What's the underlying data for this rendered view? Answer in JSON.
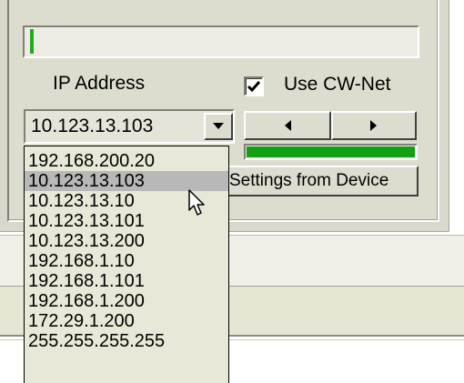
{
  "progress_top": {
    "percent": 1
  },
  "ip_address": {
    "label": "IP Address",
    "value": "10.123.13.103",
    "dropdown_icon": "chevron-down-icon",
    "options": [
      "192.168.200.20",
      "10.123.13.103",
      "10.123.13.10",
      "10.123.13.101",
      "10.123.13.200",
      "192.168.1.10",
      "192.168.1.101",
      "192.168.1.200",
      "172.29.1.200",
      "255.255.255.255"
    ],
    "highlighted_index": 1
  },
  "cw_net": {
    "label": "Use CW-Net",
    "checked": true
  },
  "nav": {
    "prev_icon": "arrow-left-icon",
    "next_icon": "arrow-right-icon"
  },
  "progress_mid": {
    "percent": 100
  },
  "settings_button": {
    "label": "Settings from Device"
  },
  "colors": {
    "progress_green": "#11a011",
    "highlight": "#b8b8b8",
    "panel": "#dcdccf"
  }
}
